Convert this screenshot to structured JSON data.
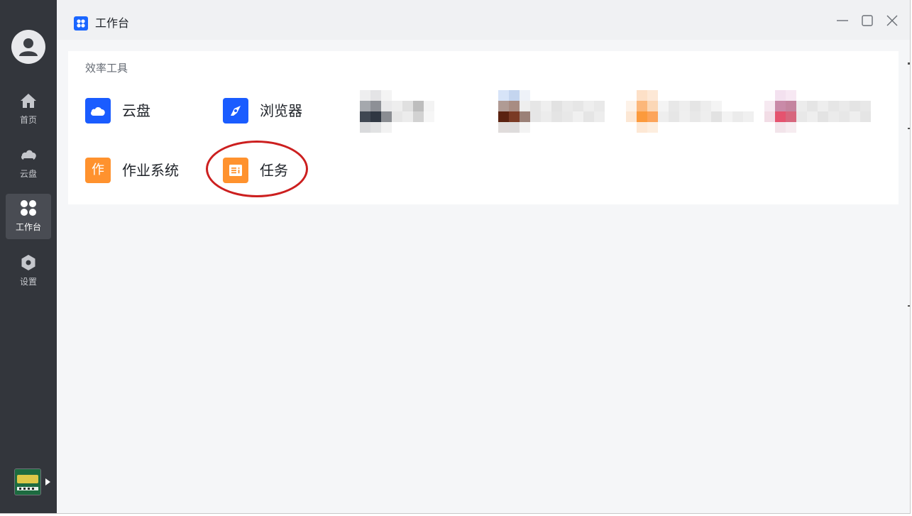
{
  "window": {
    "title": "工作台"
  },
  "sidebar": {
    "items": [
      {
        "label": "首页",
        "icon": "home-icon"
      },
      {
        "label": "云盘",
        "icon": "cloud-icon"
      },
      {
        "label": "工作台",
        "icon": "workbench-icon",
        "active": true
      },
      {
        "label": "设置",
        "icon": "settings-icon"
      }
    ],
    "app_icon": "classroom-app-icon"
  },
  "workbench": {
    "section_title": "效率工具",
    "tools": [
      {
        "label": "云盘",
        "icon": "cloud-icon",
        "color": "#1a5cff"
      },
      {
        "label": "浏览器",
        "icon": "compass-icon",
        "color": "#1a5cff"
      },
      {
        "label": "作业系统",
        "icon_text": "作",
        "color": "#ff922e"
      },
      {
        "label": "任务",
        "icon": "task-list-icon",
        "color": "#ff922e",
        "highlighted": true
      }
    ]
  },
  "colors": {
    "sidebar_bg": "#33363c",
    "accent_blue": "#1a5cff",
    "accent_orange": "#ff922e",
    "annotation_red": "#cc1f1f"
  }
}
